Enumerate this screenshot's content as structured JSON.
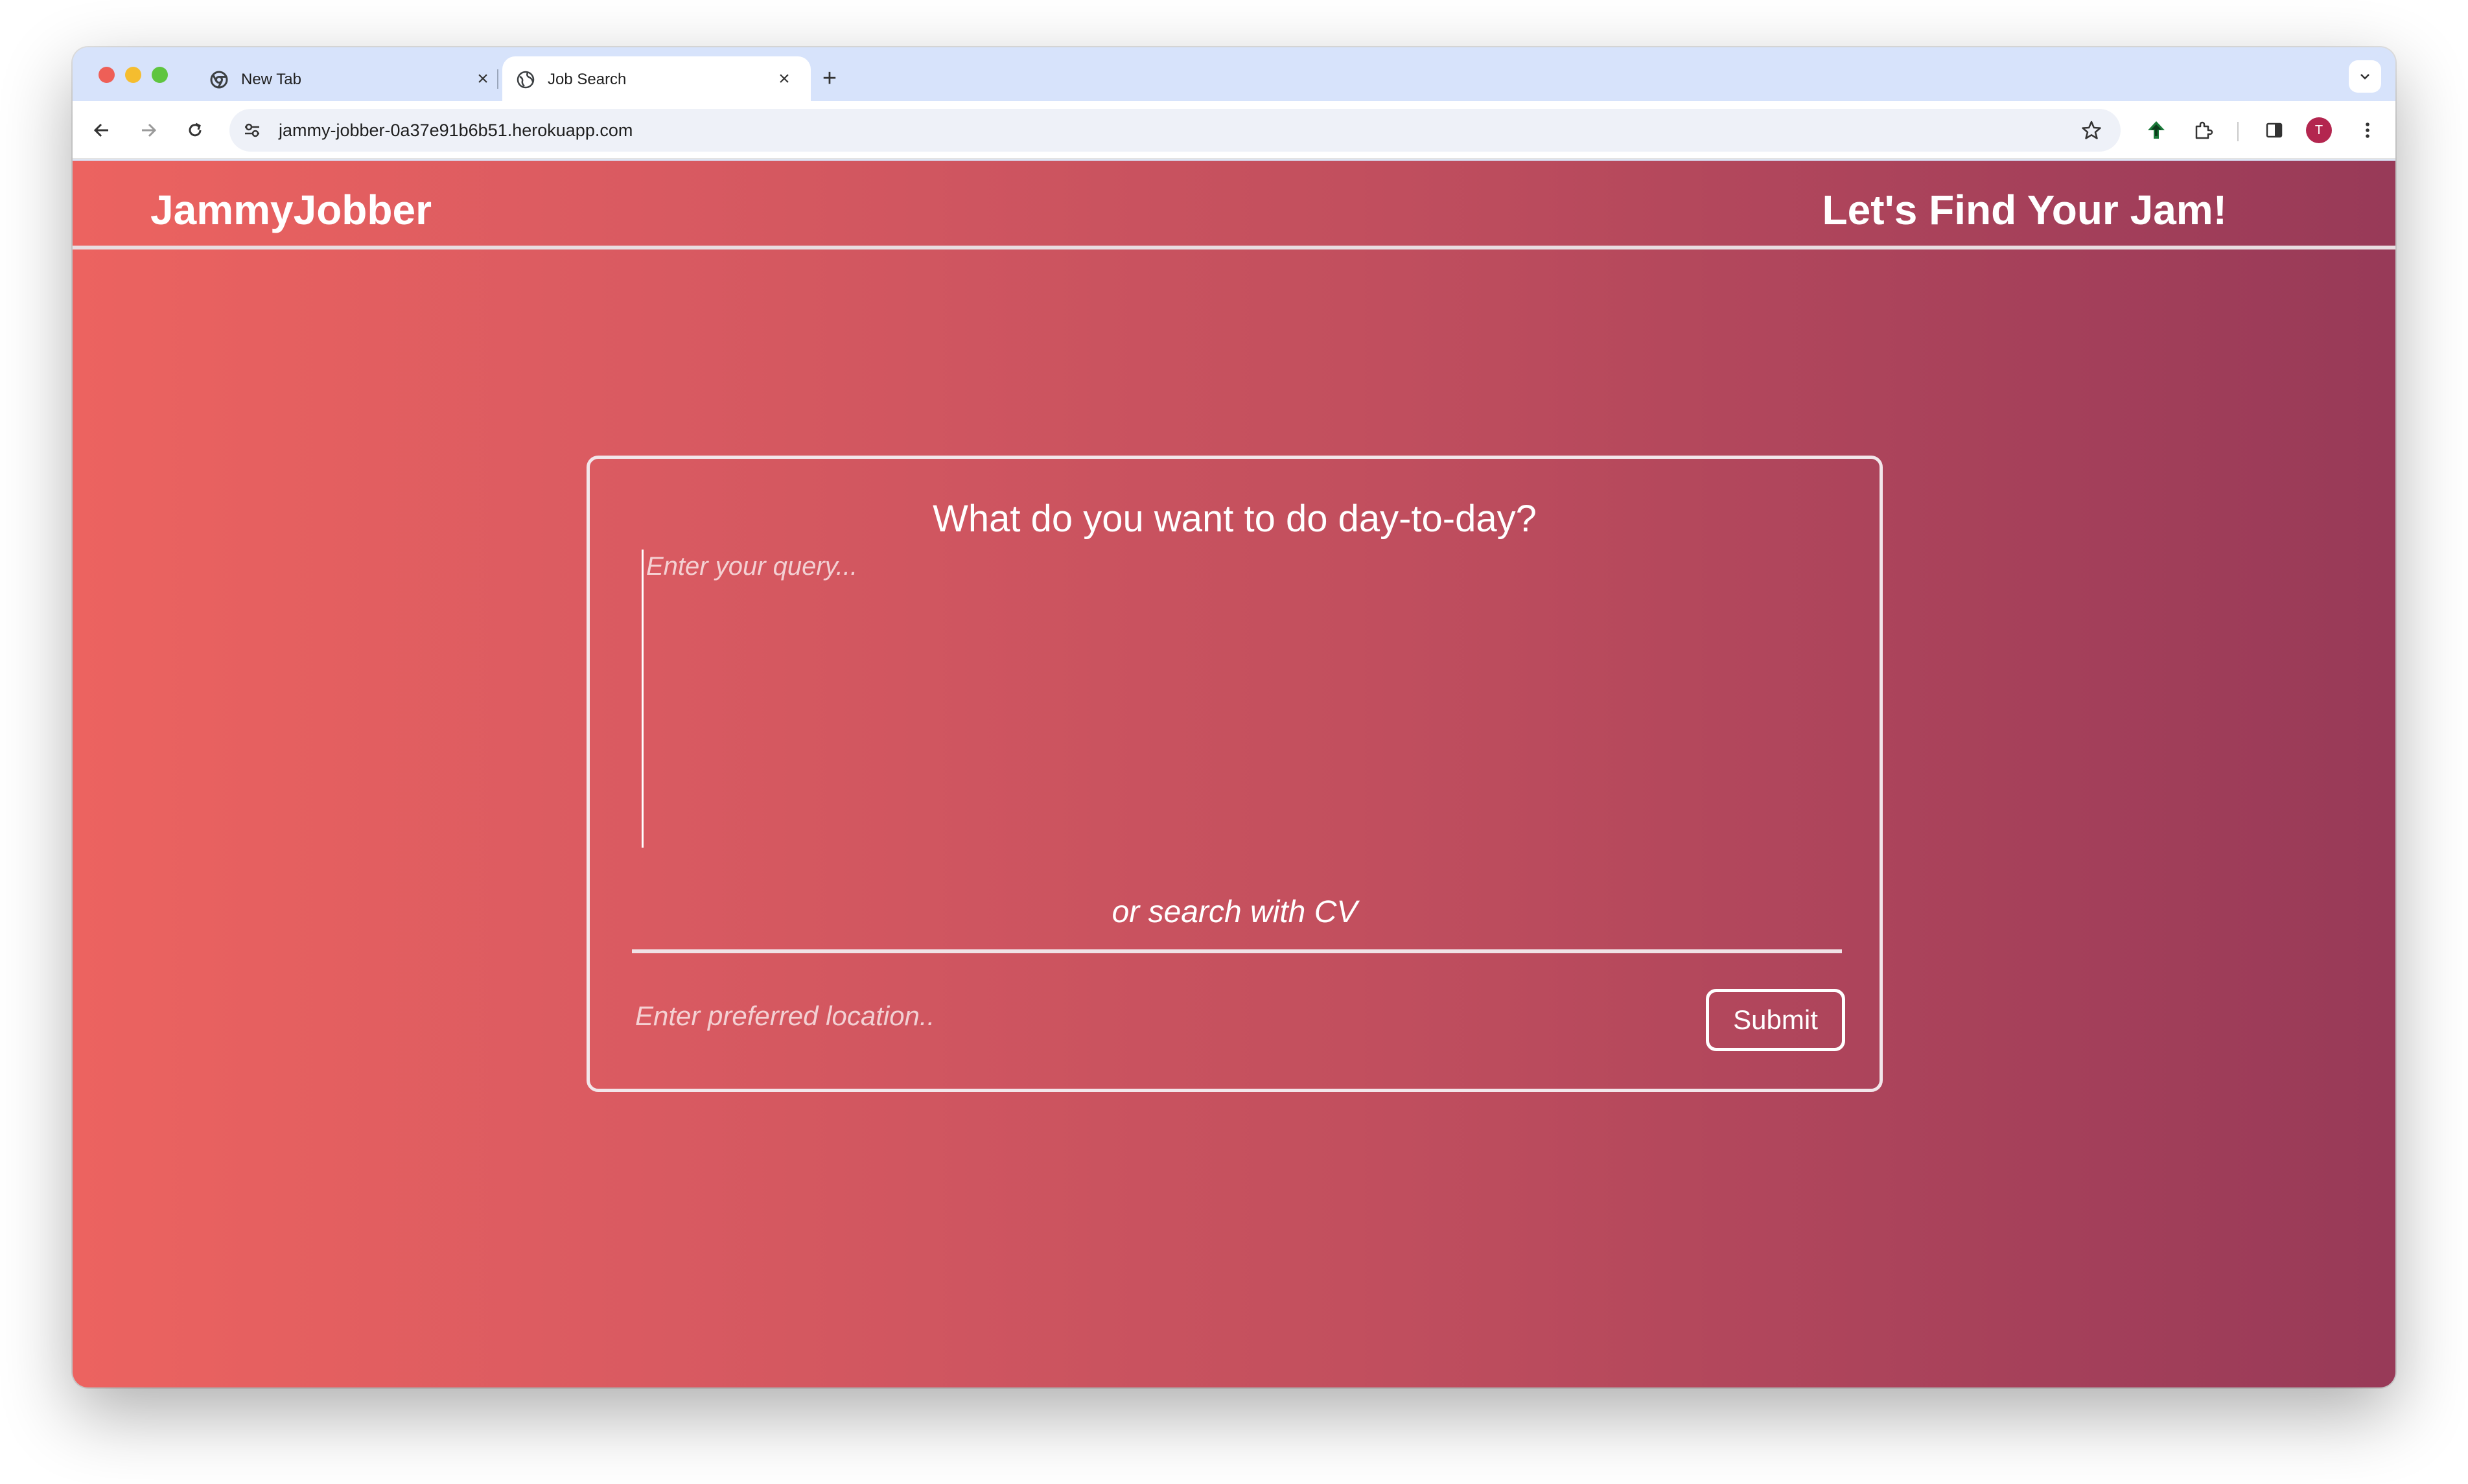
{
  "browser": {
    "tabs": [
      {
        "title": "New Tab",
        "favicon": "chrome-icon",
        "active": false
      },
      {
        "title": "Job Search",
        "favicon": "globe-icon",
        "active": true
      }
    ],
    "url": "jammy-jobber-0a37e91b6b51.herokuapp.com",
    "profile_initial": "T"
  },
  "header": {
    "brand": "JammyJobber",
    "tagline": "Let's Find Your Jam!"
  },
  "search": {
    "heading": "What do you want to do day-to-day?",
    "query_placeholder": "Enter your query...",
    "cv_link": "or search with CV",
    "location_placeholder": "Enter preferred location..",
    "submit_label": "Submit"
  },
  "colors": {
    "gradient_start": "#ec6360",
    "gradient_end": "#983a58",
    "text": "#ffffff"
  }
}
